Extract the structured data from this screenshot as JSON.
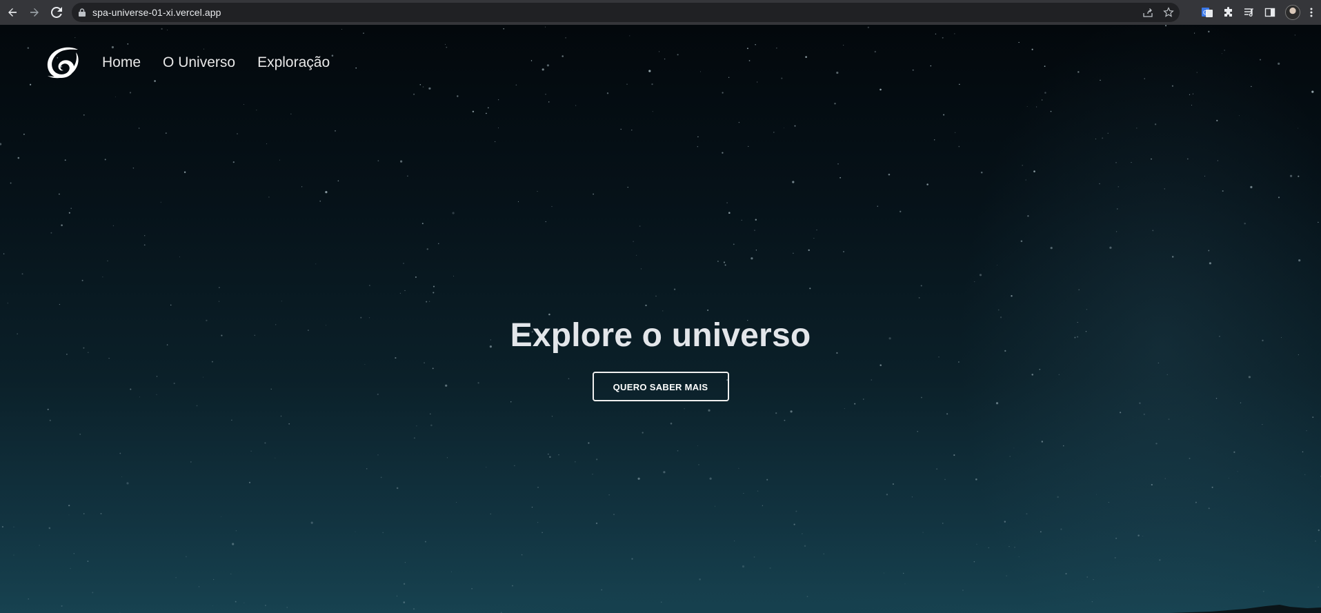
{
  "browser": {
    "url": "spa-universe-01-xi.vercel.app"
  },
  "site": {
    "nav": [
      {
        "label": "Home"
      },
      {
        "label": "O Universo"
      },
      {
        "label": "Exploração"
      }
    ]
  },
  "hero": {
    "title": "Explore o universo",
    "button_label": "QUERO SABER MAIS"
  },
  "colors": {
    "chrome_bar": "#35363a",
    "omnibox": "#202124",
    "sky_top": "#03080c",
    "sky_bottom": "#174250",
    "text": "#e8e8e8"
  }
}
